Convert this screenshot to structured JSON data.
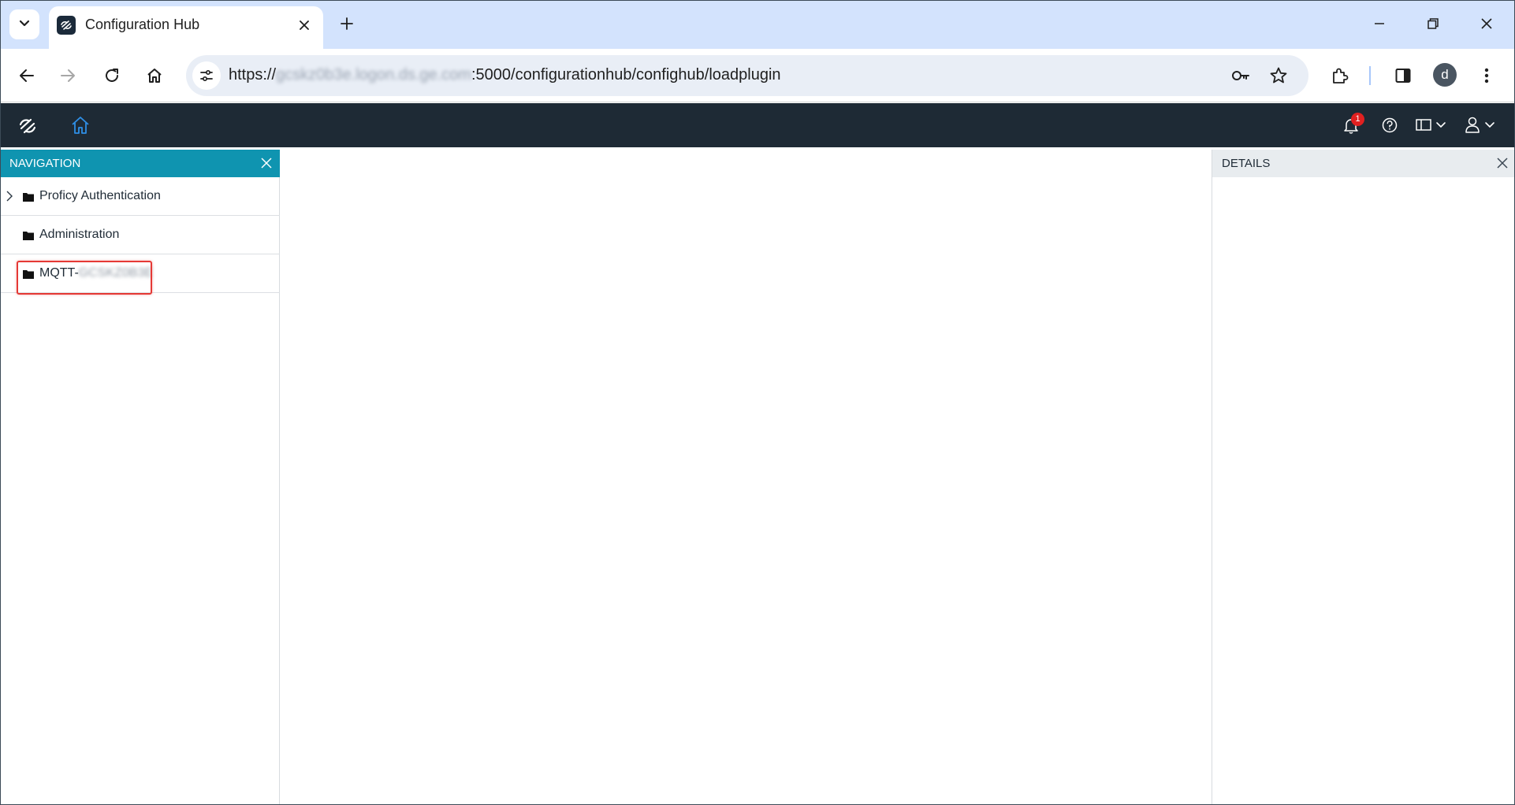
{
  "browser": {
    "tab_title": "Configuration Hub",
    "url_blurred": "gcskz0b3e.logon.ds.ge.com",
    "url_prefix": "https://",
    "url_suffix": ":5000/configurationhub/confighub/loadplugin",
    "profile_initial": "d"
  },
  "appbar": {
    "notification_count": "1"
  },
  "navigation": {
    "title": "NAVIGATION",
    "items": [
      {
        "label": "Proficy Authentication",
        "expandable": true
      },
      {
        "label": "Administration",
        "expandable": false
      },
      {
        "label": "MQTT-",
        "label_blurred": "GCSKZ0B3E",
        "expandable": false,
        "highlighted": true
      }
    ]
  },
  "details": {
    "title": "DETAILS"
  },
  "colors": {
    "tabstrip": "#d3e3fd",
    "appbar": "#1e2a35",
    "nav_header": "#0f94b0",
    "details_header": "#e8ecef",
    "highlight": "#e53935",
    "badge": "#e02020"
  }
}
